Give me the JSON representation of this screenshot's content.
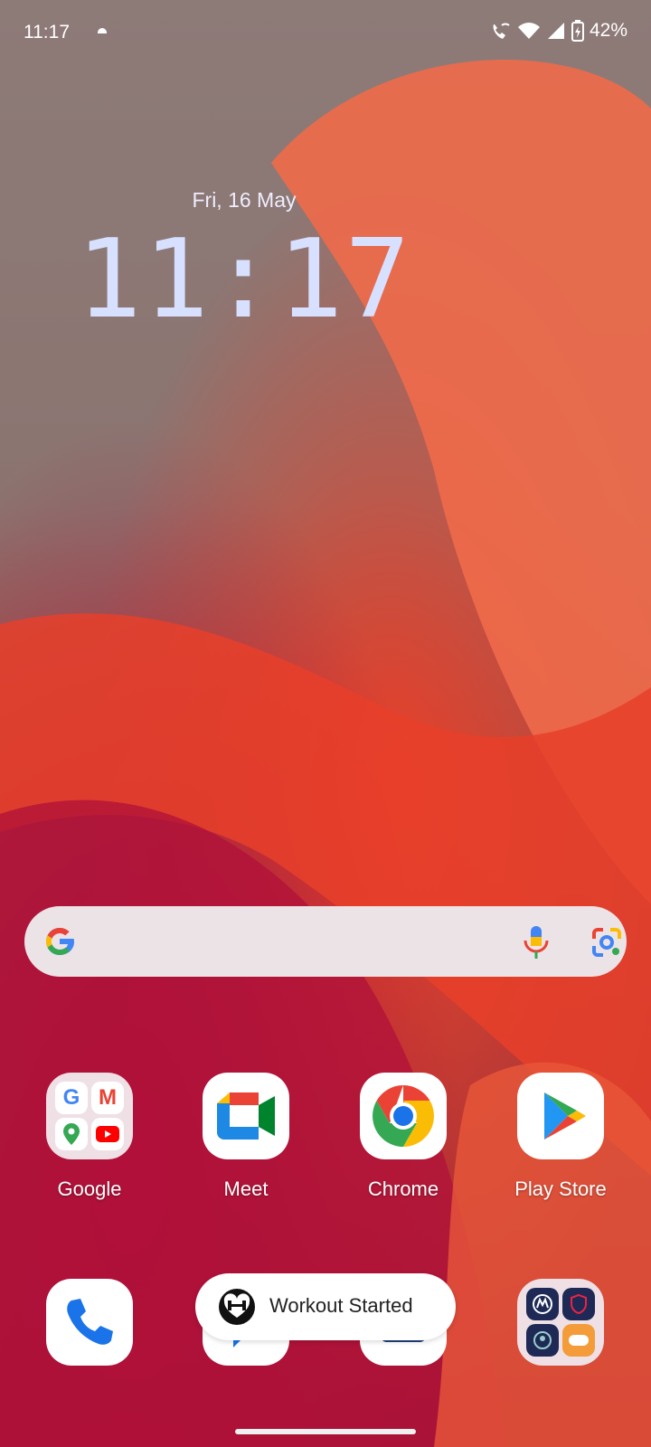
{
  "status_bar": {
    "time": "11:17",
    "battery": "42%"
  },
  "clock_widget": {
    "date": "Fri, 16 May",
    "time": "11:17"
  },
  "search_bar": {},
  "apps": [
    {
      "label": "Google",
      "icon": "google-folder-icon"
    },
    {
      "label": "Meet",
      "icon": "meet-icon"
    },
    {
      "label": "Chrome",
      "icon": "chrome-icon"
    },
    {
      "label": "Play Store",
      "icon": "play-store-icon"
    }
  ],
  "dock": [
    {
      "icon": "phone-icon"
    },
    {
      "icon": "messages-icon"
    },
    {
      "icon": "camera-icon"
    },
    {
      "icon": "moto-folder-icon"
    }
  ],
  "toast": {
    "text": "Workout Started",
    "icon": "dumbbell-heart-icon"
  }
}
